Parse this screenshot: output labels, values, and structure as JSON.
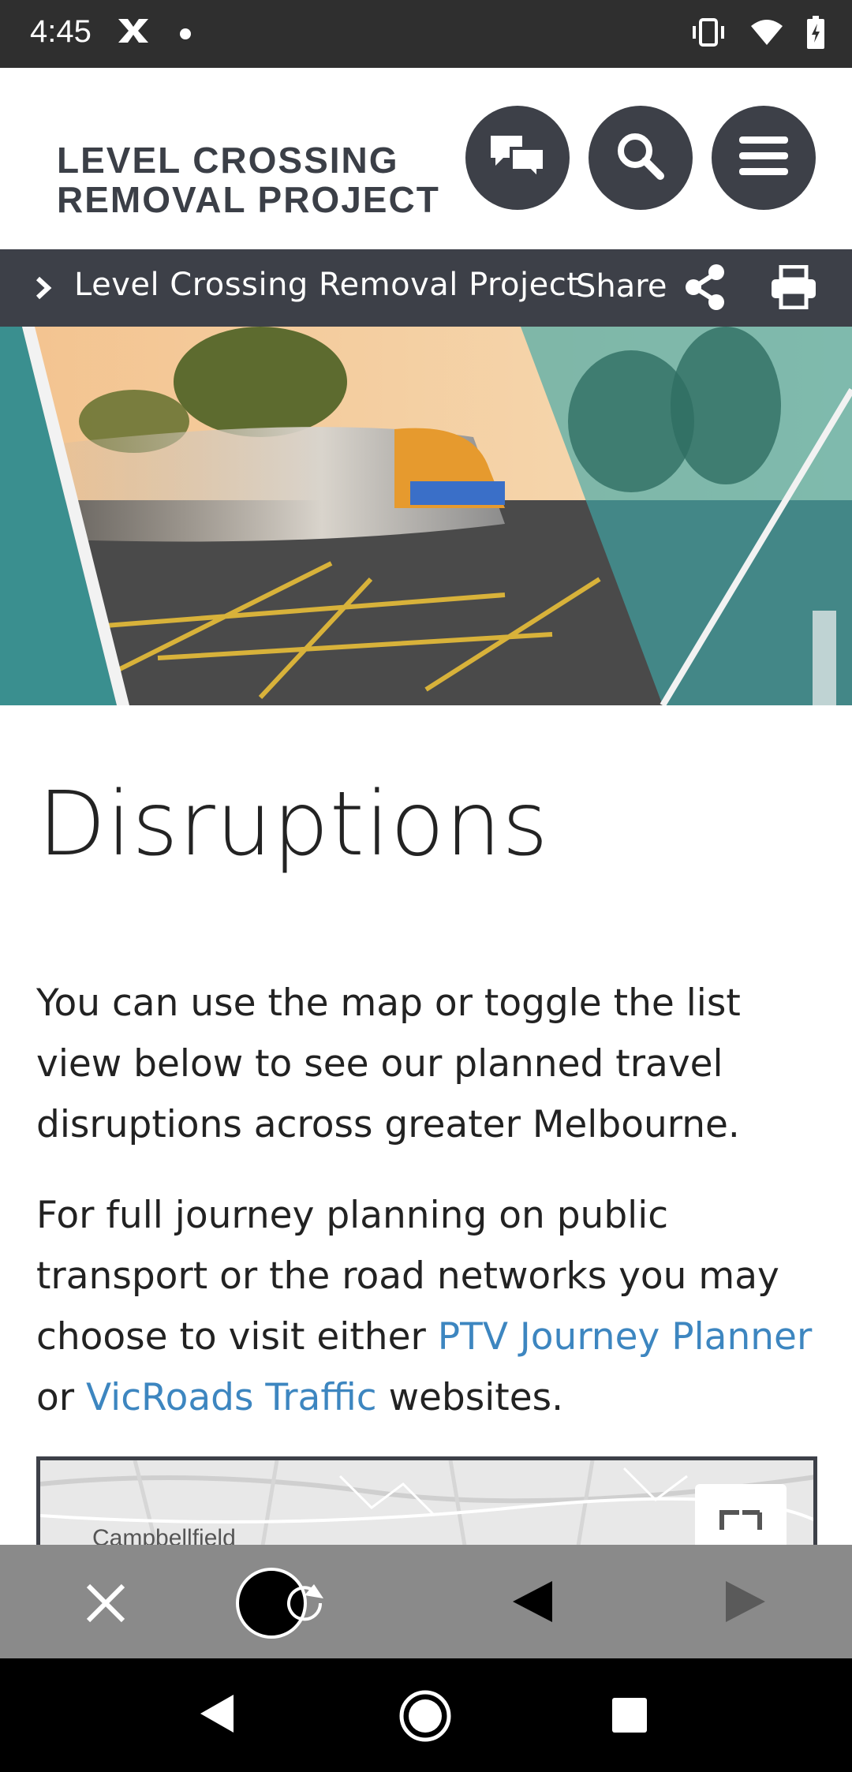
{
  "status_bar": {
    "time": "4:45",
    "notification_icon": "xbox-icon",
    "icons": [
      "vibrate-icon",
      "wifi-icon",
      "battery-charging-icon"
    ]
  },
  "header": {
    "logo_line1": "LEVEL CROSSING",
    "logo_line2": "REMOVAL PROJECT",
    "buttons": [
      "chat-icon",
      "search-icon",
      "menu-icon"
    ]
  },
  "breadcrumb": {
    "label": "Level Crossing Removal Project",
    "share_label": "Share"
  },
  "main": {
    "title": "Disruptions",
    "intro": "You can use the map or toggle the list view below to see our planned travel disruptions across greater Melbourne.",
    "journey_text_before": "For full journey planning on public transport or the road networks you may choose to visit either ",
    "link_ptv": "PTV Journey Planner",
    "journey_text_mid": " or ",
    "link_vicroads": "VicRoads Traffic",
    "journey_text_after": " websites.",
    "map_label": "Campbellfield"
  },
  "colors": {
    "dark": "#3d4048",
    "link": "#3d86c0",
    "teal": "#3f9ea0"
  }
}
